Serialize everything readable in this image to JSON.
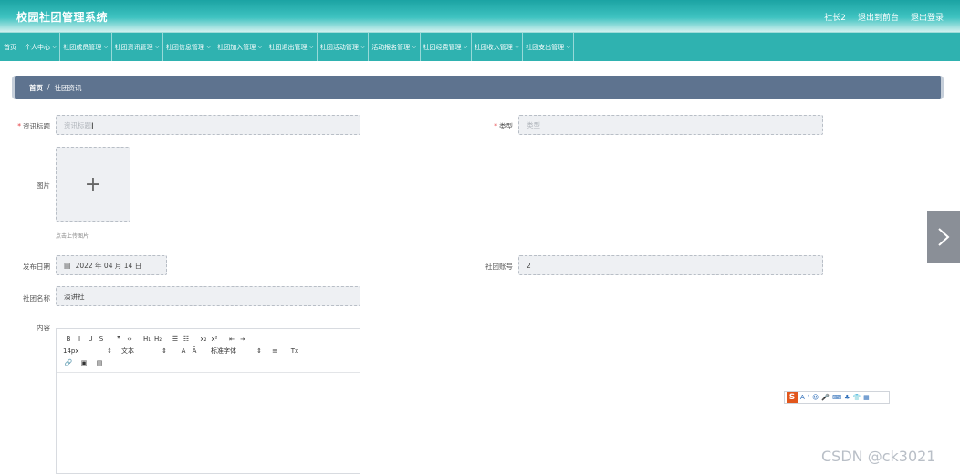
{
  "header": {
    "app_title": "校园社团管理系统",
    "links": [
      "社长2",
      "退出到前台",
      "退出登录"
    ]
  },
  "nav": {
    "items": [
      {
        "label": "首页",
        "caret": false
      },
      {
        "label": "个人中心",
        "caret": true
      },
      {
        "label": "社团成员管理",
        "caret": true
      },
      {
        "label": "社团资讯管理",
        "caret": true
      },
      {
        "label": "社团信息管理",
        "caret": true
      },
      {
        "label": "社团加入管理",
        "caret": true
      },
      {
        "label": "社团退出管理",
        "caret": true
      },
      {
        "label": "社团活动管理",
        "caret": true
      },
      {
        "label": "活动报名管理",
        "caret": true
      },
      {
        "label": "社团经费管理",
        "caret": true
      },
      {
        "label": "社团收入管理",
        "caret": true
      },
      {
        "label": "社团支出管理",
        "caret": true
      }
    ],
    "caret_glyph": "⌵"
  },
  "breadcrumb": {
    "home": "首页",
    "separator": "/",
    "current": "社团资讯"
  },
  "form": {
    "title_label": "资讯标题",
    "title_placeholder": "资讯标题",
    "type_label": "类型",
    "type_placeholder": "类型",
    "image_label": "图片",
    "upload_hint": "点击上传图片",
    "date_label": "发布日期",
    "date_value": "2022 年 04 月 14 日",
    "account_label": "社团账号",
    "account_value": "2",
    "club_name_label": "社团名称",
    "club_name_value": "演讲社",
    "content_label": "内容",
    "required_mark": "*"
  },
  "editor": {
    "row1": [
      "B",
      "I",
      "U",
      "S",
      "|",
      "❞",
      "‹›",
      "|",
      "H₁",
      "H₂",
      "|",
      "☰",
      "☷",
      "|",
      "x₂",
      "x²",
      "|",
      "⇤",
      "⇥"
    ],
    "font_size": "14px",
    "text_style": "文本",
    "font_family": "标准字体",
    "row2_icons": [
      "A",
      "Ā",
      "≡",
      "Tx"
    ],
    "row3_icons": [
      "🔗",
      "▣",
      "▤"
    ]
  },
  "ime": {
    "logo": "S",
    "icons": [
      "A",
      "ʼ",
      "☺",
      "🎤",
      "⌨",
      "♣",
      "👕",
      "▦"
    ]
  },
  "watermark": "CSDN @ck3021",
  "colors": {
    "topbar": "#1ba3a3",
    "navbar": "#2fb2b0",
    "breadcrumb": "#5e738f",
    "input_bg": "#eef0f3",
    "required": "#e4393c"
  }
}
